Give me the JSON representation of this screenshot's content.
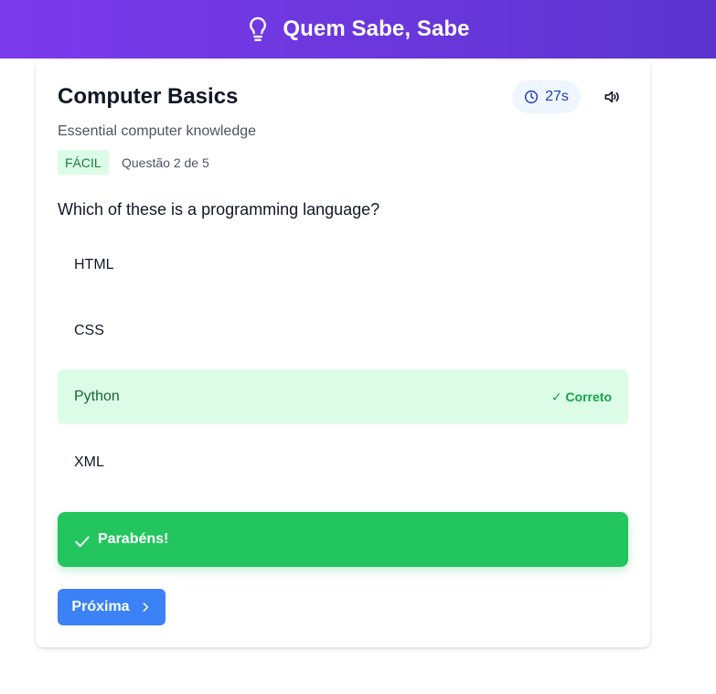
{
  "header": {
    "title": "Quem Sabe, Sabe",
    "icon": "lightbulb-icon"
  },
  "quiz": {
    "title": "Computer Basics",
    "subtitle": "Essential computer knowledge",
    "difficulty": "FÁCIL",
    "progress": "Questão 2 de 5",
    "timer": "27s",
    "question": "Which of these is a programming language?",
    "options": [
      {
        "label": "HTML",
        "state": "default"
      },
      {
        "label": "CSS",
        "state": "default"
      },
      {
        "label": "Python",
        "state": "correct",
        "mark": "✓ Correto"
      },
      {
        "label": "XML",
        "state": "default"
      }
    ],
    "feedback": "Parabéns!",
    "next_label": "Próxima"
  },
  "colors": {
    "header_gradient_start": "#7c3aed",
    "header_gradient_end": "#5b34d0",
    "correct_bg": "#dcfce7",
    "success": "#22c55e",
    "primary_button": "#3b82f6"
  }
}
